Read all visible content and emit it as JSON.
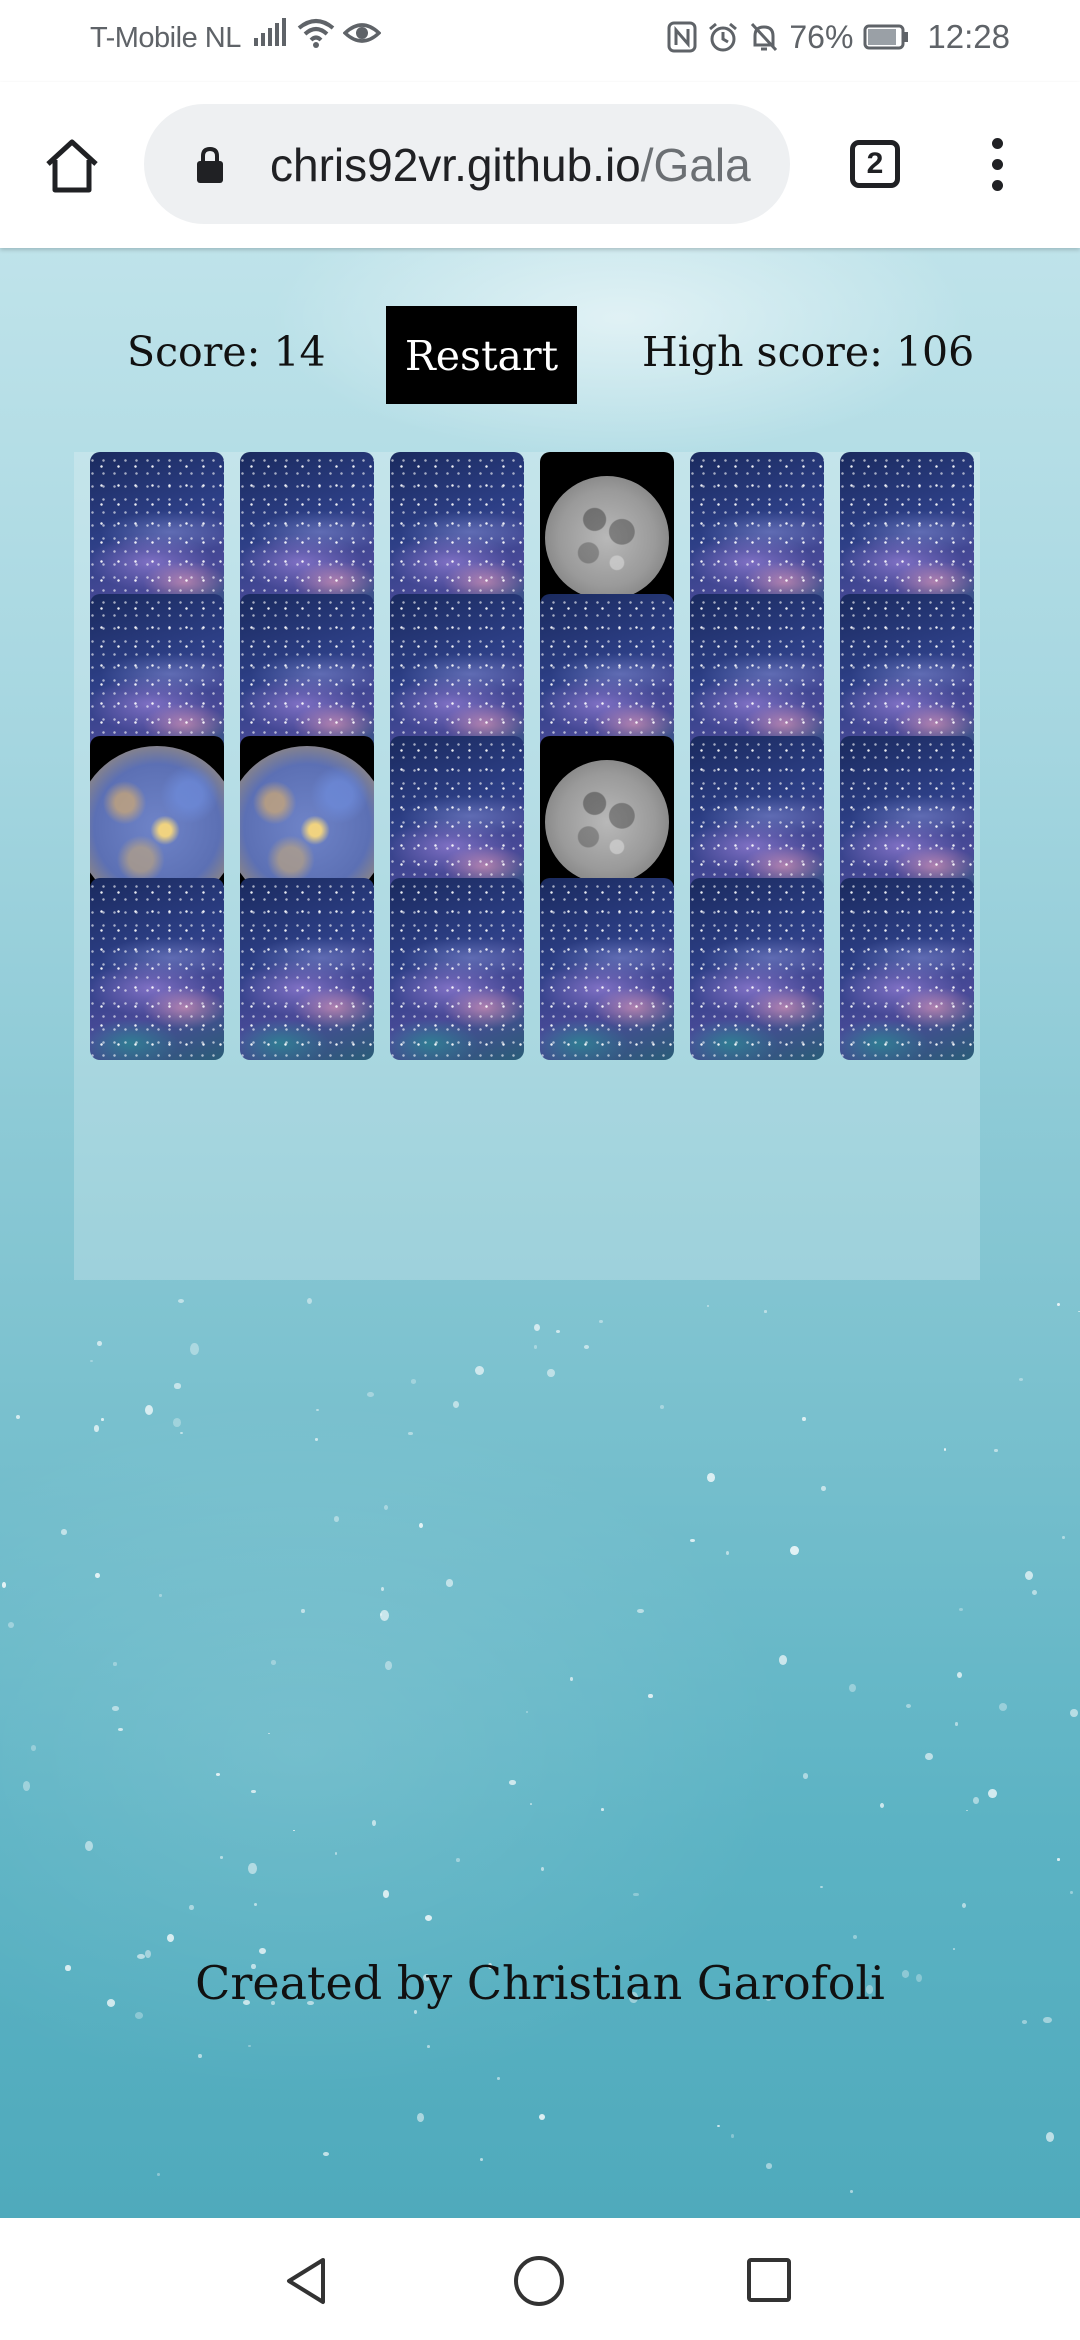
{
  "status_bar": {
    "carrier": "T-Mobile NL",
    "battery": "76%",
    "time": "12:28",
    "icons": [
      "signal-icon",
      "wifi-icon",
      "eye-icon",
      "nfc-icon",
      "alarm-icon",
      "bell-off-icon",
      "battery-icon"
    ]
  },
  "browser": {
    "url_main": "chris92vr.github.io",
    "url_rest": "/Gala",
    "tab_count": "2"
  },
  "game": {
    "score_text": "Score: 14",
    "restart_label": "Restart",
    "high_score_text": "High score: 106",
    "rows": [
      [
        {
          "state": "back"
        },
        {
          "state": "back"
        },
        {
          "state": "back"
        },
        {
          "state": "front",
          "name": "moon"
        },
        {
          "state": "back"
        },
        {
          "state": "back"
        }
      ],
      [
        {
          "state": "back"
        },
        {
          "state": "back"
        },
        {
          "state": "back"
        },
        {
          "state": "back"
        },
        {
          "state": "back"
        },
        {
          "state": "back"
        }
      ],
      [
        {
          "state": "front",
          "name": "mercury"
        },
        {
          "state": "front",
          "name": "mercury"
        },
        {
          "state": "back"
        },
        {
          "state": "front",
          "name": "moon"
        },
        {
          "state": "back"
        },
        {
          "state": "back"
        }
      ],
      [
        {
          "state": "back"
        },
        {
          "state": "back"
        },
        {
          "state": "back"
        },
        {
          "state": "back"
        },
        {
          "state": "back"
        },
        {
          "state": "back"
        }
      ]
    ]
  },
  "footer": {
    "credit": "Created by Christian Garofoli"
  },
  "colors": {
    "page_background": "#7fc3d0",
    "restart_background": "#000000",
    "card_front_background": "#000000"
  }
}
